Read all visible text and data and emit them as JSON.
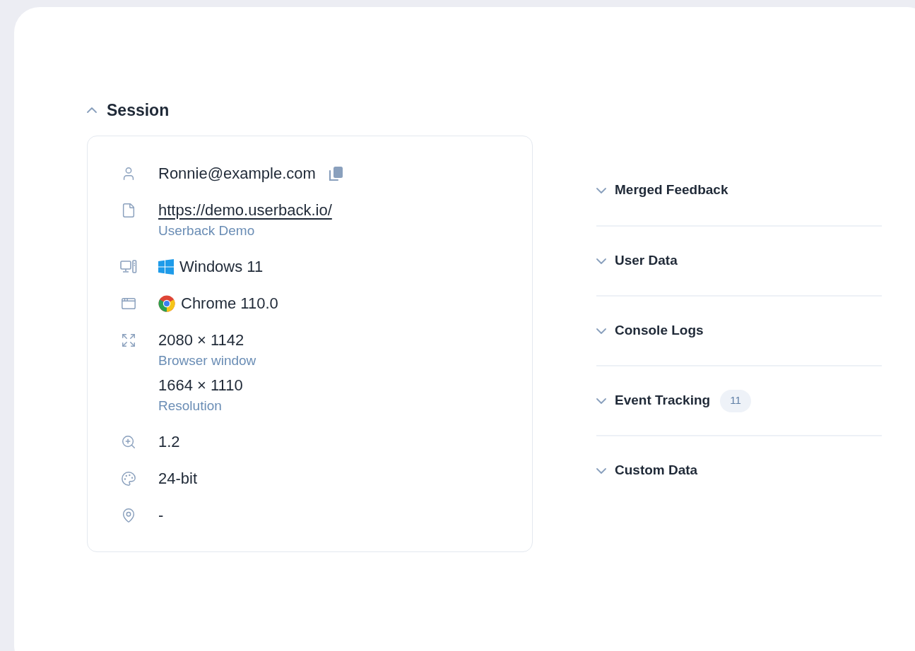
{
  "session": {
    "title": "Session",
    "expanded": true,
    "items": [
      {
        "kind": "user",
        "copyable": true,
        "lines": [
          {
            "kind": "value",
            "text": "Ronnie@example.com"
          }
        ]
      },
      {
        "kind": "page",
        "copyable": false,
        "lines": [
          {
            "kind": "link",
            "text": "https://demo.userback.io/"
          },
          {
            "kind": "caption",
            "text": "Userback Demo"
          }
        ]
      },
      {
        "kind": "os",
        "copyable": false,
        "lines": [
          {
            "kind": "value",
            "text": "Windows 11"
          }
        ]
      },
      {
        "kind": "browser",
        "copyable": false,
        "lines": [
          {
            "kind": "value",
            "text": "Chrome 110.0"
          }
        ]
      },
      {
        "kind": "size",
        "copyable": false,
        "lines": [
          {
            "kind": "value",
            "text": "2080 × 1142"
          },
          {
            "kind": "caption",
            "text": "Browser window"
          },
          {
            "kind": "value",
            "text": "1664 × 1110"
          },
          {
            "kind": "caption",
            "text": "Resolution"
          }
        ]
      },
      {
        "kind": "zoom",
        "copyable": false,
        "lines": [
          {
            "kind": "value",
            "text": "1.2"
          }
        ]
      },
      {
        "kind": "color",
        "copyable": false,
        "lines": [
          {
            "kind": "value",
            "text": "24-bit"
          }
        ]
      },
      {
        "kind": "location",
        "copyable": false,
        "lines": [
          {
            "kind": "value",
            "text": "-"
          }
        ]
      }
    ]
  },
  "sections": [
    {
      "title": "Merged Feedback",
      "expanded": false
    },
    {
      "title": "User Data",
      "expanded": false
    },
    {
      "title": "Console Logs",
      "expanded": false
    },
    {
      "title": "Event Tracking",
      "expanded": false,
      "count": "11"
    },
    {
      "title": "Custom Data",
      "expanded": false
    }
  ]
}
